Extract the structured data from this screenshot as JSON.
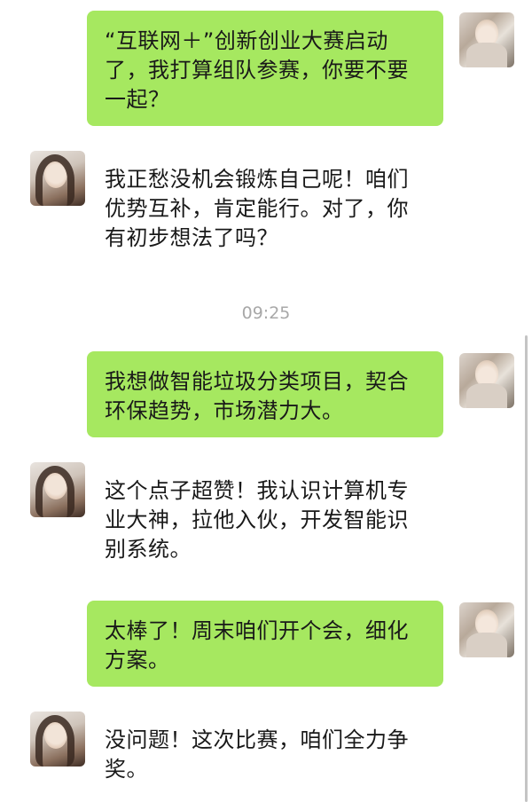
{
  "time_divider": "09:25",
  "messages": [
    {
      "from": "self",
      "text": "“互联网＋”创新创业大赛启动了，我打算组队参赛，你要不要一起？"
    },
    {
      "from": "other",
      "text": "我正愁没机会锻炼自己呢！咱们优势互补，肯定能行。对了，你有初步想法了吗？"
    },
    {
      "from": "self",
      "text": "我想做智能垃圾分类项目，契合环保趋势，市场潜力大。"
    },
    {
      "from": "other",
      "text": "这个点子超赞！我认识计算机专业大神，拉他入伙，开发智能识别系统。"
    },
    {
      "from": "self",
      "text": "太棒了！周末咱们开个会，细化方案。"
    },
    {
      "from": "other",
      "text": "没问题！这次比赛，咱们全力争奖。"
    }
  ]
}
